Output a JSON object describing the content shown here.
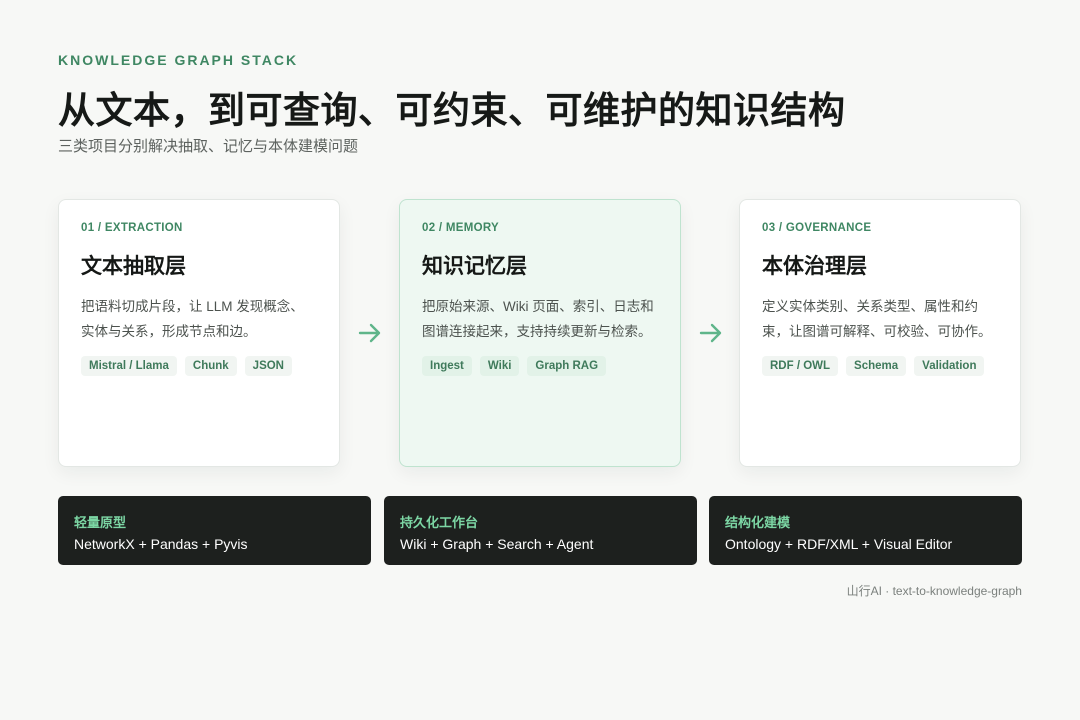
{
  "header": {
    "eyebrow": "KNOWLEDGE GRAPH STACK",
    "title": "从文本，到可查询、可约束、可维护的知识结构",
    "subtitle": "三类项目分别解决抽取、记忆与本体建模问题"
  },
  "cards": [
    {
      "kicker": "01 / EXTRACTION",
      "title": "文本抽取层",
      "desc": "把语料切成片段，让 LLM 发现概念、实体与关系，形成节点和边。",
      "tags": [
        "Mistral / Llama",
        "Chunk",
        "JSON"
      ]
    },
    {
      "kicker": "02 / MEMORY",
      "title": "知识记忆层",
      "desc": "把原始来源、Wiki 页面、索引、日志和图谱连接起来，支持持续更新与检索。",
      "tags": [
        "Ingest",
        "Wiki",
        "Graph RAG"
      ]
    },
    {
      "kicker": "03 / GOVERNANCE",
      "title": "本体治理层",
      "desc": "定义实体类别、关系类型、属性和约束，让图谱可解释、可校验、可协作。",
      "tags": [
        "RDF / OWL",
        "Schema",
        "Validation"
      ]
    }
  ],
  "bars": [
    {
      "title": "轻量原型",
      "text": "NetworkX + Pandas + Pyvis"
    },
    {
      "title": "持久化工作台",
      "text": "Wiki + Graph + Search + Agent"
    },
    {
      "title": "结构化建模",
      "text": "Ontology + RDF/XML + Visual Editor"
    }
  ],
  "footer": "山行AI · text-to-knowledge-graph",
  "colors": {
    "accent": "#3f8763",
    "highlight_card_bg": "#eef8f2",
    "bar_bg": "#1d201e",
    "bar_title": "#7cd6a4"
  },
  "icons": [
    "arrow-right-icon",
    "arrow-right-icon"
  ]
}
